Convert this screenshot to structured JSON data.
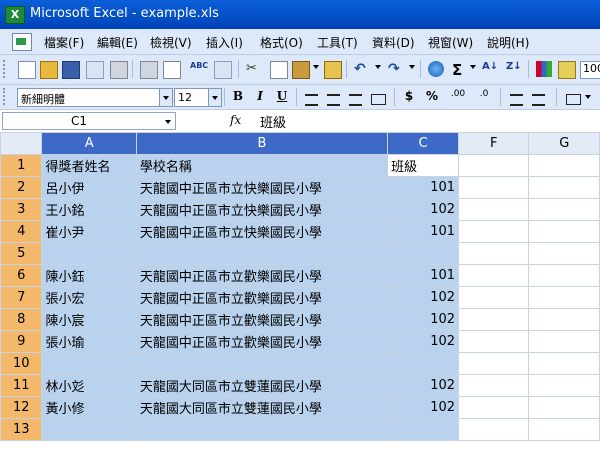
{
  "window": {
    "title": "Microsoft Excel - example.xls"
  },
  "menu": [
    "檔案(F)",
    "編輯(E)",
    "檢視(V)",
    "插入(I)",
    "格式(O)",
    "工具(T)",
    "資料(D)",
    "視窗(W)",
    "說明(H)"
  ],
  "toolbar": {
    "zoom": "100"
  },
  "format_toolbar": {
    "font": "新細明體",
    "size": "12",
    "bold": "B",
    "italic": "I",
    "underline": "U",
    "currency": "$",
    "percent": "%",
    "inc_decimal": ".00",
    "dec_decimal": ".0"
  },
  "formula_bar": {
    "name_box": "C1",
    "fx": "fx",
    "value": "班級"
  },
  "grid": {
    "columns": [
      "A",
      "B",
      "C",
      "F",
      "G"
    ],
    "rows": [
      {
        "num": "1",
        "a": "得獎者姓名",
        "b": "學校名稱",
        "c": "班級"
      },
      {
        "num": "2",
        "a": "呂小伊",
        "b": "天龍國中正區市立快樂國民小學",
        "c": "101"
      },
      {
        "num": "3",
        "a": "王小銘",
        "b": "天龍國中正區市立快樂國民小學",
        "c": "102"
      },
      {
        "num": "4",
        "a": "崔小尹",
        "b": "天龍國中正區市立快樂國民小學",
        "c": "101"
      },
      {
        "num": "5",
        "a": "",
        "b": "",
        "c": ""
      },
      {
        "num": "6",
        "a": "陳小鈺",
        "b": "天龍國中正區市立歡樂國民小學",
        "c": "101"
      },
      {
        "num": "7",
        "a": "張小宏",
        "b": "天龍國中正區市立歡樂國民小學",
        "c": "102"
      },
      {
        "num": "8",
        "a": "陳小宸",
        "b": "天龍國中正區市立歡樂國民小學",
        "c": "102"
      },
      {
        "num": "9",
        "a": "張小瑜",
        "b": "天龍國中正區市立歡樂國民小學",
        "c": "102"
      },
      {
        "num": "10",
        "a": "",
        "b": "",
        "c": ""
      },
      {
        "num": "11",
        "a": "林小彣",
        "b": "天龍國大同區市立雙蓮國民小學",
        "c": "102"
      },
      {
        "num": "12",
        "a": "黃小修",
        "b": "天龍國大同區市立雙蓮國民小學",
        "c": "102"
      },
      {
        "num": "13",
        "a": "",
        "b": "",
        "c": ""
      }
    ]
  }
}
